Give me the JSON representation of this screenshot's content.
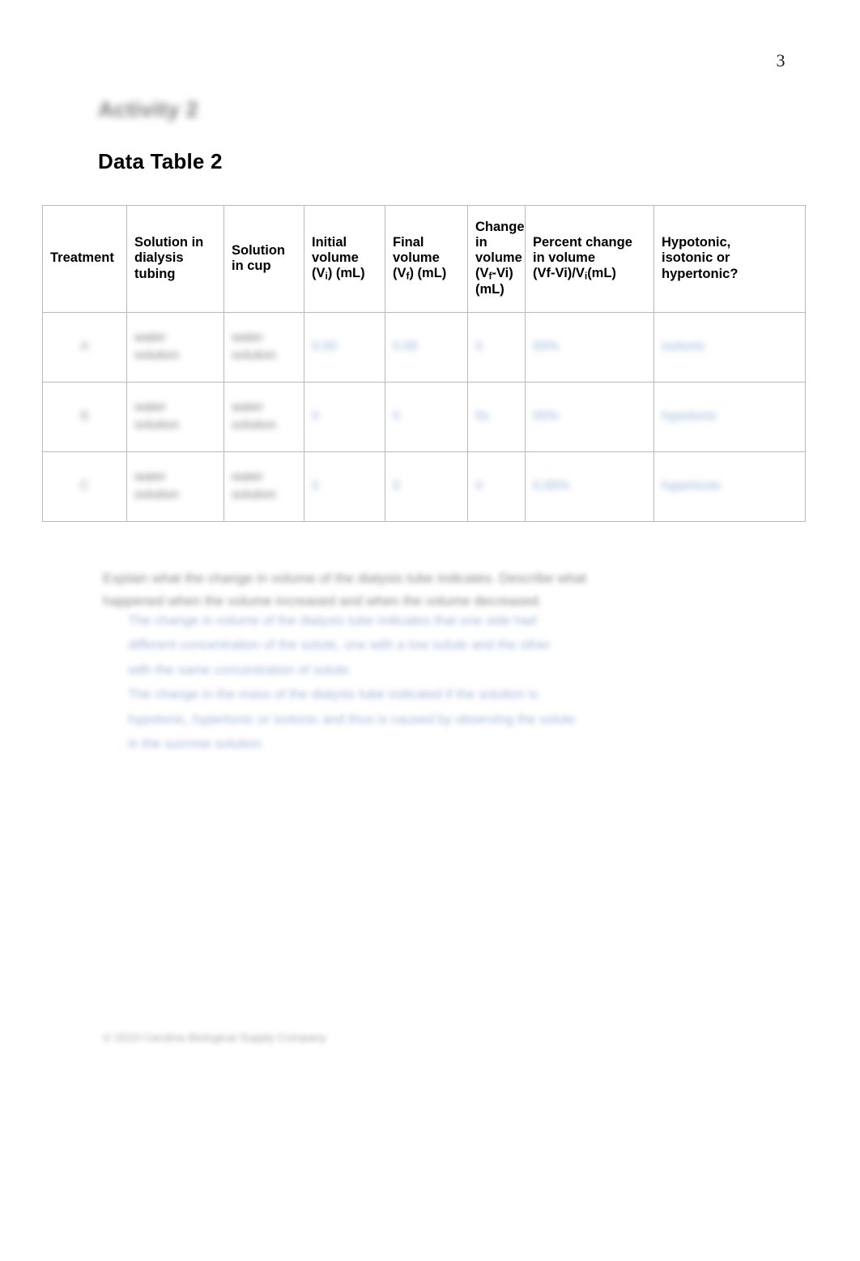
{
  "page": {
    "number": "3"
  },
  "headings": {
    "activity": "Activity 2",
    "data_table": "Data Table 2"
  },
  "table": {
    "columns": [
      {
        "key": "treatment",
        "label": "Treatment"
      },
      {
        "key": "solution_tubing",
        "label": "Solution in dialysis tubing"
      },
      {
        "key": "solution_cup",
        "label": "Solution in cup"
      },
      {
        "key": "initial_volume",
        "label": "Initial volume (Vi) (mL)"
      },
      {
        "key": "final_volume",
        "label": "Final volume (Vf) (mL)"
      },
      {
        "key": "change_volume",
        "label": "Change in volume (Vf-Vi) (mL)"
      },
      {
        "key": "percent_change",
        "label": "Percent change in volume (Vf-Vi)/Vi(mL)"
      },
      {
        "key": "tonicity",
        "label": "Hypotonic, isotonic or hypertonic?"
      }
    ],
    "rows": [
      {
        "treatment": "A",
        "solution_tubing_line1": "water",
        "solution_tubing_line2": "solution",
        "solution_cup_line1": "water",
        "solution_cup_line2": "solution",
        "initial_volume": "0.00",
        "final_volume": "0.00",
        "change_volume": "0",
        "percent_change": "00%",
        "tonicity": "isotonic"
      },
      {
        "treatment": "B",
        "solution_tubing_line1": "water",
        "solution_tubing_line2": "solution",
        "solution_cup_line1": "water",
        "solution_cup_line2": "solution",
        "initial_volume": "0",
        "final_volume": "0",
        "change_volume": "0s",
        "percent_change": "00%",
        "tonicity": "hypotonic"
      },
      {
        "treatment": "C",
        "solution_tubing_line1": "water",
        "solution_tubing_line2": "solution",
        "solution_cup_line1": "water",
        "solution_cup_line2": "solution",
        "initial_volume": "0",
        "final_volume": "0",
        "change_volume": "0",
        "percent_change": "0.00%",
        "tonicity": "hypertonic"
      }
    ]
  },
  "question": {
    "text": "Explain what the change in volume of the dialysis tube indicates. Describe what happened when the volume increased and when the volume decreased."
  },
  "answer": {
    "lines": [
      "The change in volume of the dialysis tube indicates that one side had",
      "different concentration of the solute, one with a low solute and the other",
      "with the same concentration of solute.",
      "The change in the mass of the dialysis tube indicated if the solution is",
      "hypotonic, hypertonic or isotonic and thus is caused by observing the solute",
      "in the sucrose solution."
    ]
  },
  "footer": {
    "text": "© 2023 Carolina Biological Supply Company"
  },
  "colors": {
    "answer_text": "#4a6fb0",
    "table_border": "#b9b9b9",
    "heading": "#000000"
  }
}
